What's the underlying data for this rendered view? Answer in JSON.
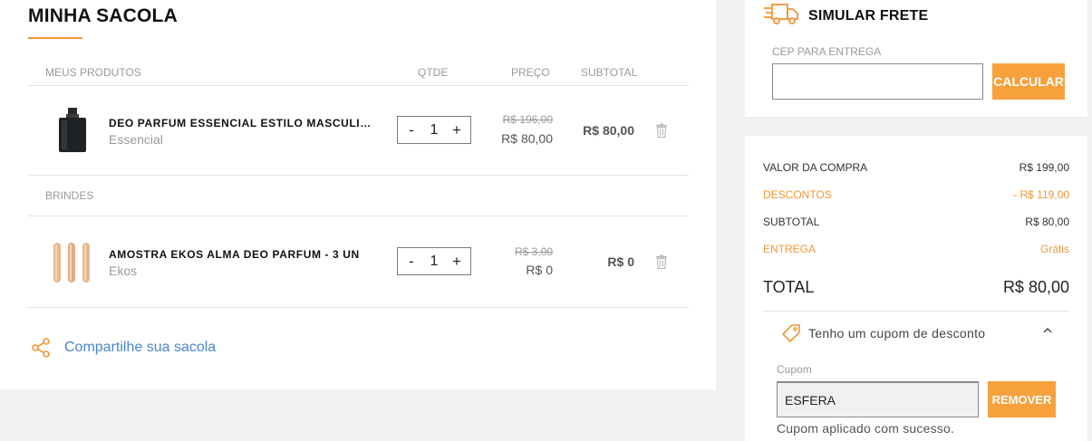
{
  "cart": {
    "title": "MINHA SACOLA",
    "columns": {
      "products": "MEUS PRODUTOS",
      "qty": "QTDE",
      "price": "PREÇO",
      "subtotal": "SUBTOTAL"
    },
    "items": [
      {
        "name": "DEO PARFUM ESSENCIAL ESTILO MASCULINO",
        "brand": "Essencial",
        "qty": "1",
        "old_price": "R$ 196,00",
        "price": "R$ 80,00",
        "subtotal": "R$ 80,00",
        "image": "perfume-bottle"
      }
    ],
    "gifts_label": "BRINDES",
    "gifts": [
      {
        "name": "AMOSTRA EKOS ALMA DEO PARFUM - 3 UN",
        "brand": "Ekos",
        "qty": "1",
        "old_price": "R$ 3,00",
        "price": "R$ 0",
        "subtotal": "R$ 0",
        "image": "sample-vials"
      }
    ],
    "share_label": "Compartilhe sua sacola",
    "qty_minus": "-",
    "qty_plus": "+"
  },
  "shipping": {
    "title": "SIMULAR FRETE",
    "cep_label": "CEP PARA ENTREGA",
    "cep_value": "",
    "calc_label": "CALCULAR"
  },
  "summary": {
    "rows": [
      {
        "label": "VALOR DA COMPRA",
        "value": "R$ 199,00"
      },
      {
        "label": "DESCONTOS",
        "value": "- R$ 119,00"
      },
      {
        "label": "SUBTOTAL",
        "value": "R$ 80,00"
      },
      {
        "label": "ENTREGA",
        "value": "Grátis"
      }
    ],
    "total_label": "TOTAL",
    "total_value": "R$ 80,00",
    "coupon_toggle": "Tenho um cupom de desconto",
    "coupon_label": "Cupom",
    "coupon_value": "ESFERA",
    "remove_label": "REMOVER",
    "coupon_message": "Cupom aplicado com sucesso."
  },
  "colors": {
    "accent": "#f7a13d",
    "link": "#4a86c8",
    "muted": "#9a9a9a"
  }
}
